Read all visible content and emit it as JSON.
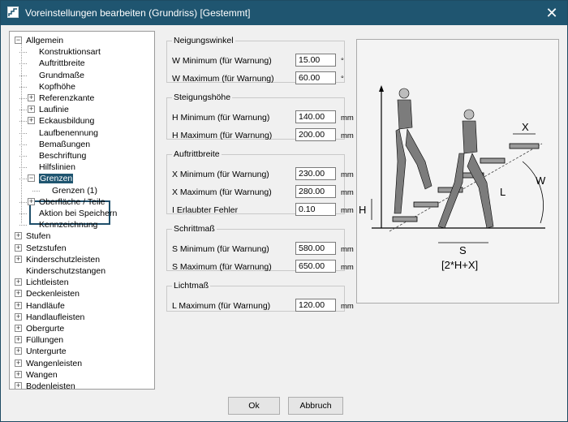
{
  "window": {
    "title": "Voreinstellungen bearbeiten (Grundriss) [Gestemmt]",
    "close_glyph": "✕"
  },
  "tree": {
    "items": [
      {
        "label": "Allgemein",
        "exp": "-"
      },
      {
        "label": "Konstruktionsart"
      },
      {
        "label": "Auftrittbreite"
      },
      {
        "label": "Grundmaße"
      },
      {
        "label": "Kopfhöhe"
      },
      {
        "label": "Referenzkante",
        "exp": "+"
      },
      {
        "label": "Laufinie",
        "exp": "+"
      },
      {
        "label": "Eckausbildung",
        "exp": "+"
      },
      {
        "label": "Laufbenennung"
      },
      {
        "label": "Bemaßungen"
      },
      {
        "label": "Beschriftung"
      },
      {
        "label": "Hilfslinien"
      },
      {
        "label": "Grenzen",
        "exp": "-",
        "selected": true
      },
      {
        "label": "Grenzen (1)"
      },
      {
        "label": "Oberfläche / Teile",
        "exp": "+"
      },
      {
        "label": "Aktion bei Speichern"
      },
      {
        "label": "Kennzeichnung"
      },
      {
        "label": "Stufen",
        "exp": "+"
      },
      {
        "label": "Setzstufen",
        "exp": "+"
      },
      {
        "label": "Kinderschutzleisten",
        "exp": "+"
      },
      {
        "label": "Kinderschutzstangen"
      },
      {
        "label": "Lichtleisten",
        "exp": "+"
      },
      {
        "label": "Deckenleisten",
        "exp": "+"
      },
      {
        "label": "Handläufe",
        "exp": "+"
      },
      {
        "label": "Handlaufleisten",
        "exp": "+"
      },
      {
        "label": "Obergurte",
        "exp": "+"
      },
      {
        "label": "Füllungen",
        "exp": "+"
      },
      {
        "label": "Untergurte",
        "exp": "+"
      },
      {
        "label": "Wangenleisten",
        "exp": "+"
      },
      {
        "label": "Wangen",
        "exp": "+"
      },
      {
        "label": "Bodenleisten",
        "exp": "+"
      }
    ]
  },
  "groups": {
    "neigung": {
      "title": "Neigungswinkel",
      "rows": [
        {
          "label": "W Minimum (für Warnung)",
          "value": "15.00",
          "unit": "°"
        },
        {
          "label": "W Maximum (für Warnung)",
          "value": "60.00",
          "unit": "°"
        }
      ]
    },
    "steigung": {
      "title": "Steigungshöhe",
      "rows": [
        {
          "label": "H Minimum (für Warnung)",
          "value": "140.00",
          "unit": "mm"
        },
        {
          "label": "H Maximum (für Warnung)",
          "value": "200.00",
          "unit": "mm"
        }
      ]
    },
    "auftritt": {
      "title": "Auftrittbreite",
      "rows": [
        {
          "label": "X Minimum (für Warnung)",
          "value": "230.00",
          "unit": "mm"
        },
        {
          "label": "X Maximum (für Warnung)",
          "value": "280.00",
          "unit": "mm"
        },
        {
          "label": "I Erlaubter Fehler",
          "value": "0.10",
          "unit": "mm"
        }
      ]
    },
    "schritt": {
      "title": "Schrittmaß",
      "rows": [
        {
          "label": "S Minimum (für Warnung)",
          "value": "580.00",
          "unit": "mm"
        },
        {
          "label": "S Maximum (für Warnung)",
          "value": "650.00",
          "unit": "mm"
        }
      ]
    },
    "licht": {
      "title": "Lichtmaß",
      "rows": [
        {
          "label": "L Maximum (für Warnung)",
          "value": "120.00",
          "unit": "mm"
        }
      ]
    }
  },
  "diagram": {
    "label_x": "X",
    "label_l": "L",
    "label_w": "W",
    "label_h": "H",
    "label_s": "S",
    "formula": "[2*H+X]"
  },
  "buttons": {
    "ok": "Ok",
    "cancel": "Abbruch"
  },
  "colors": {
    "titlebar": "#1f5570",
    "selection": "#1f5570"
  }
}
